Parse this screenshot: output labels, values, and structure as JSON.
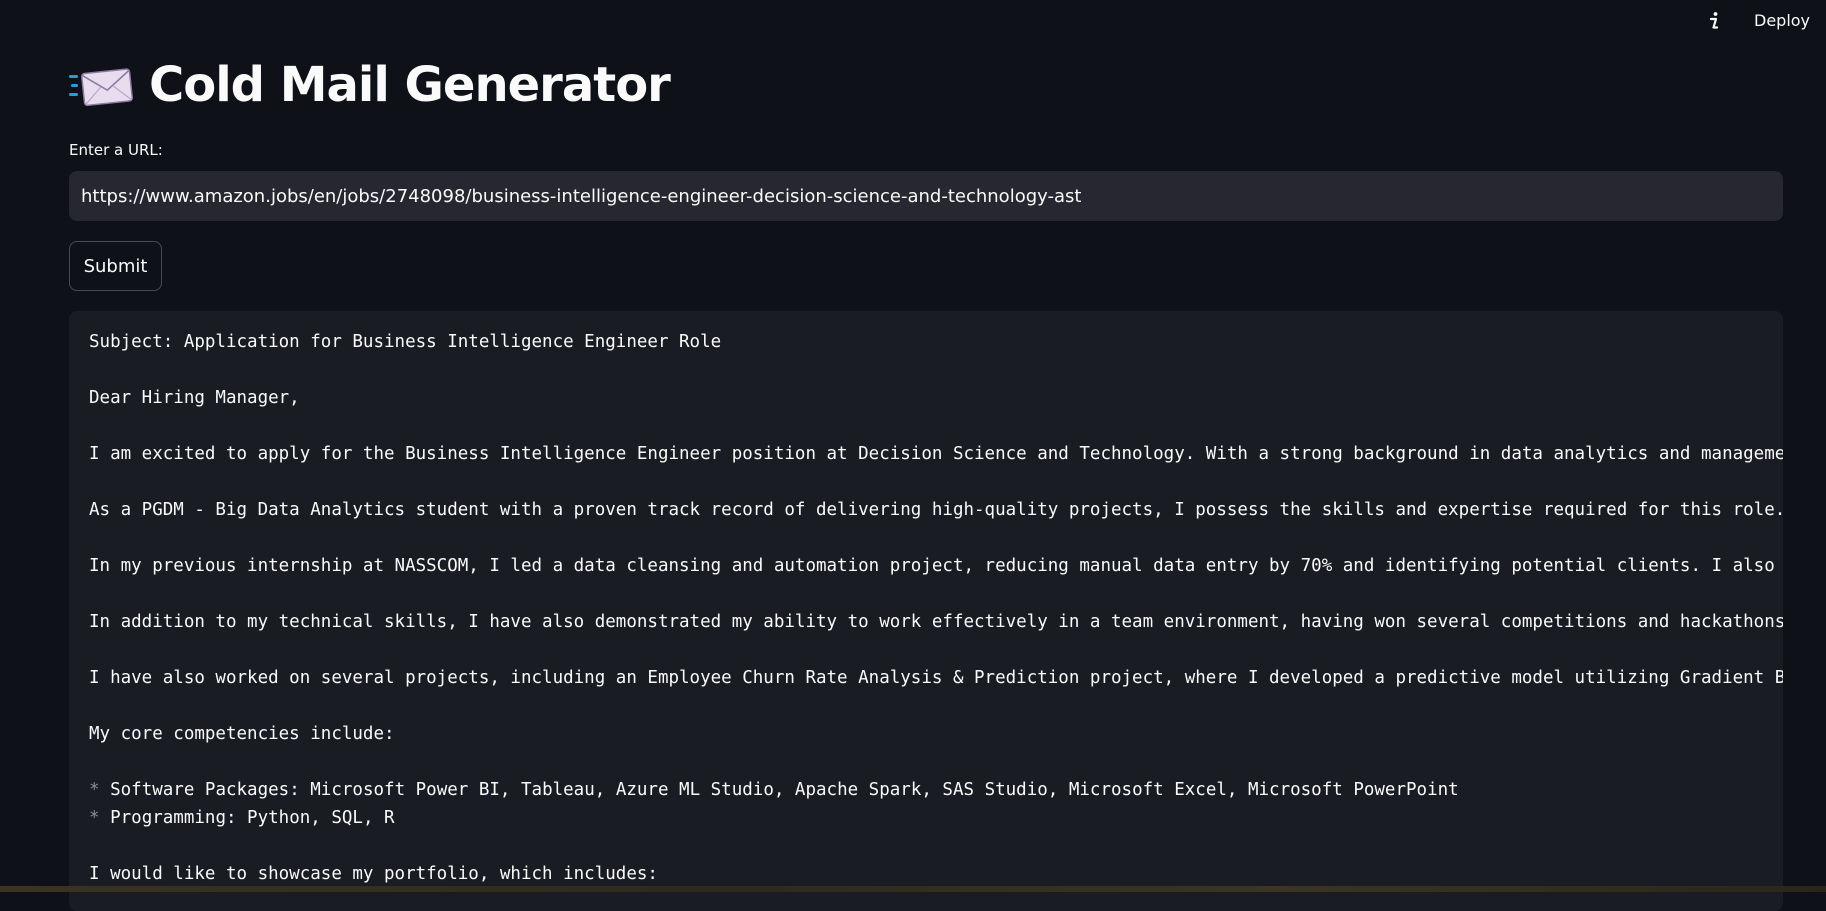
{
  "header": {
    "deploy_label": "Deploy",
    "info_icon": "info-icon"
  },
  "page": {
    "title": "Cold Mail Generator",
    "title_icon": "incoming-envelope-icon"
  },
  "url_field": {
    "label": "Enter a URL:",
    "value": "https://www.amazon.jobs/en/jobs/2748098/business-intelligence-engineer-decision-science-and-technology-ast"
  },
  "submit_label": "Submit",
  "email_output": {
    "lines": [
      "Subject: Application for Business Intelligence Engineer Role",
      "Dear Hiring Manager,",
      "I am excited to apply for the Business Intelligence Engineer position at Decision Science and Technology. With a strong background in data analytics and managemen",
      "As a PGDM - Big Data Analytics student with a proven track record of delivering high-quality projects, I possess the skills and expertise required for this role.",
      "In my previous internship at NASSCOM, I led a data cleansing and automation project, reducing manual data entry by 70% and identifying potential clients. I also d",
      "In addition to my technical skills, I have also demonstrated my ability to work effectively in a team environment, having won several competitions and hackathons",
      "I have also worked on several projects, including an Employee Churn Rate Analysis & Prediction project, where I developed a predictive model utilizing Gradient Bo",
      "My core competencies include:",
      "Software Packages: Microsoft Power BI, Tableau, Azure ML Studio, Apache Spark, SAS Studio, Microsoft Excel, Microsoft PowerPoint",
      "Programming: Python, SQL, R",
      "I would like to showcase my portfolio, which includes:"
    ],
    "bullet_char": "*"
  },
  "colors": {
    "background": "#0e1117",
    "input_background": "#262730",
    "code_background": "#1a1c24",
    "text": "#fafafa"
  }
}
